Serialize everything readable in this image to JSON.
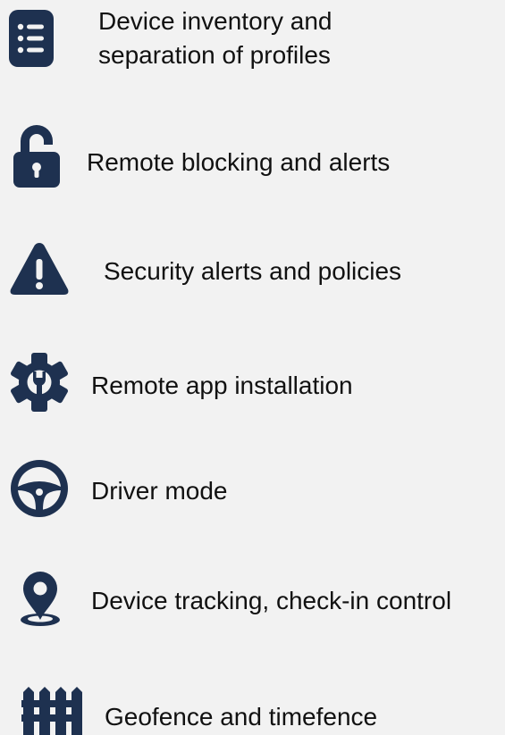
{
  "colors": {
    "icon": "#1e3150",
    "background": "#f2f2f2",
    "text": "#111111"
  },
  "features": [
    {
      "icon": "list-icon",
      "line1": "Device inventory and",
      "line2": "separation of profiles"
    },
    {
      "icon": "unlocked-padlock-icon",
      "line1": "Remote blocking and alerts"
    },
    {
      "icon": "warning-triangle-icon",
      "line1": "Security alerts and policies"
    },
    {
      "icon": "gear-wrench-icon",
      "line1": "Remote app installation"
    },
    {
      "icon": "steering-wheel-icon",
      "line1": "Driver mode"
    },
    {
      "icon": "map-pin-icon",
      "line1": "Device tracking, check-in control"
    },
    {
      "icon": "fence-icon",
      "line1": "Geofence and timefence"
    }
  ]
}
